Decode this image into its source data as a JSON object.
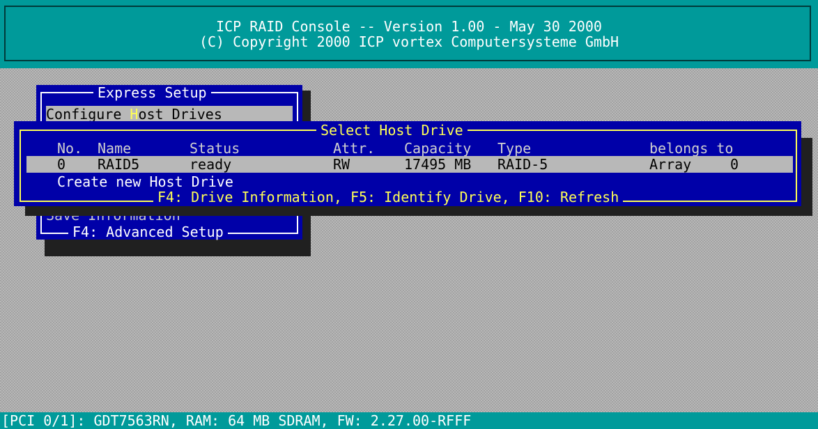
{
  "header": {
    "line1": "ICP RAID Console -- Version 1.00 - May 30 2000",
    "line2": "(C) Copyright 2000 ICP vortex Computersysteme GmbH"
  },
  "express_setup": {
    "title": "Express Setup",
    "items": [
      {
        "pre": "Configure ",
        "hotkey": "H",
        "post": "ost Drives"
      },
      {
        "label": "Save Information"
      }
    ],
    "footer": "F4: Advanced Setup"
  },
  "host_drive_dialog": {
    "title": "Select Host Drive",
    "columns": [
      "No.",
      "Name",
      "Status",
      "Attr.",
      "Capacity",
      "Type",
      "belongs to"
    ],
    "rows": [
      {
        "no": "0",
        "name": "RAID5",
        "status": "ready",
        "attr": "RW",
        "capacity": "17495 MB",
        "type": "RAID-5",
        "belongs_to": "Array",
        "belongs_num": "0"
      }
    ],
    "create_label": "Create new Host Drive",
    "footer": "F4: Drive Information, F5: Identify Drive, F10: Refresh"
  },
  "status_bar": {
    "text": "[PCI 0/1]: GDT7563RN, RAM: 64 MB SDRAM, FW: 2.27.00-RFFF"
  },
  "colors": {
    "panel": "#0000a8",
    "header": "#009a9a",
    "accent": "#ffff55"
  }
}
